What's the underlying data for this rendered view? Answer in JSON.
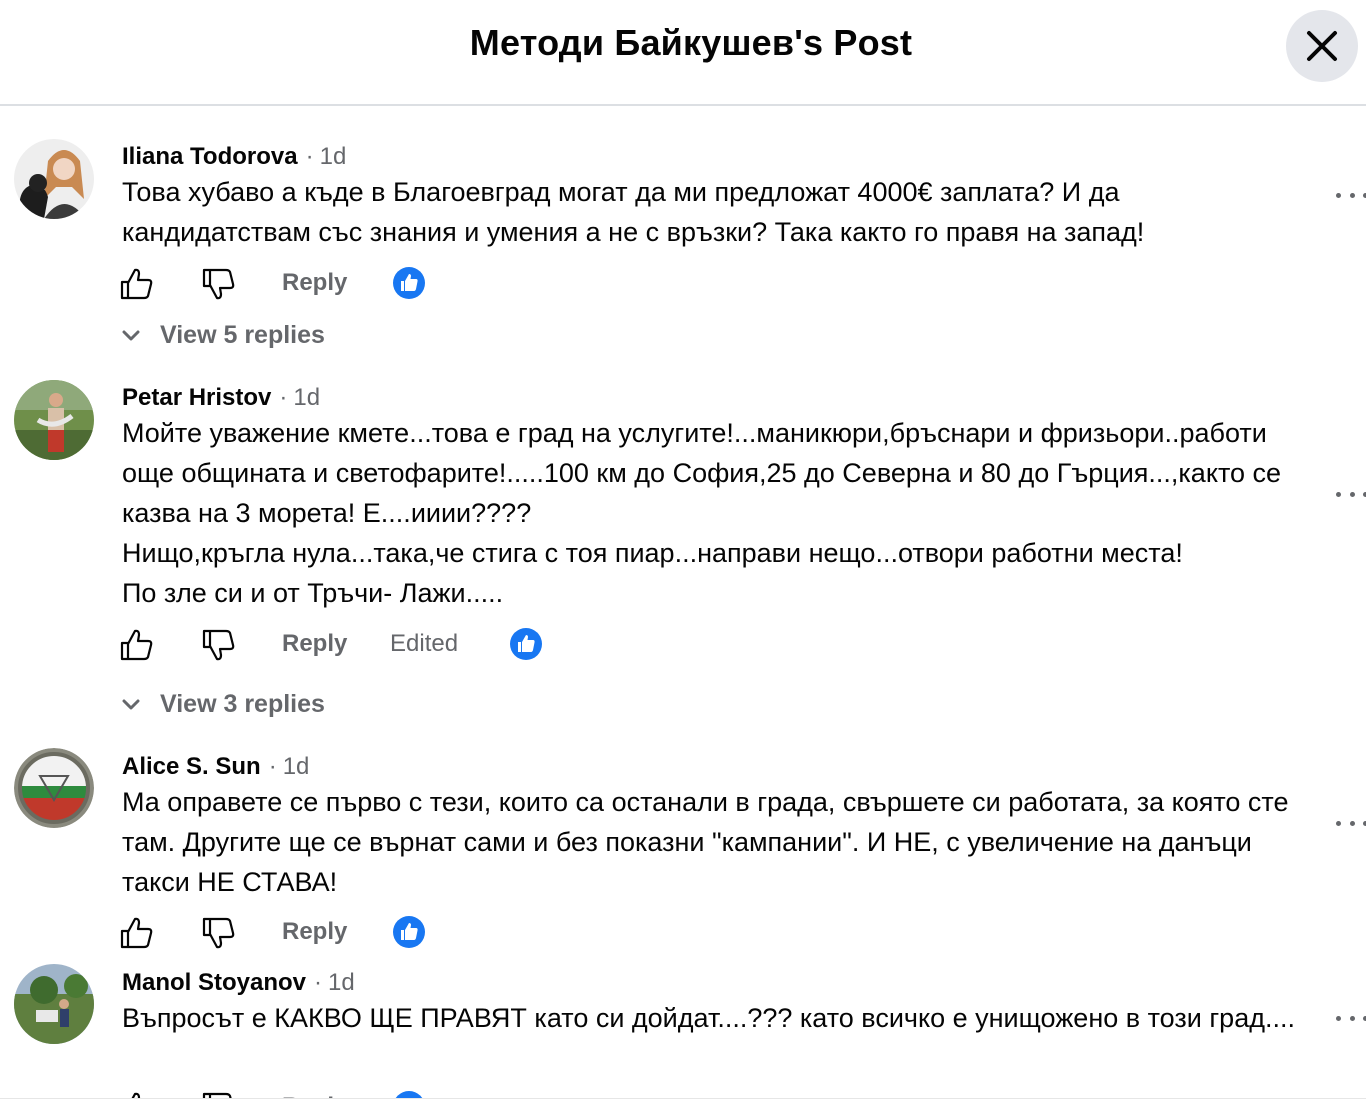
{
  "header": {
    "title": "Методи Байкушев's Post",
    "close_icon": "close-icon"
  },
  "ui": {
    "reply_label": "Reply",
    "edited_label": "Edited",
    "dot": "·",
    "like_icon": "thumbs-up-icon",
    "dislike_icon": "thumbs-down-icon",
    "more_icon": "more-horizontal-icon",
    "reaction_icon": "like-reaction-icon",
    "chevron_icon": "chevron-down-icon"
  },
  "colors": {
    "secondary_text": "#65676b",
    "reaction_blue": "#1877f2",
    "close_bg": "#e4e6eb"
  },
  "comments": [
    {
      "author": "Iliana Todorova",
      "time": "1d",
      "lines": [
        "Това хубаво а къде в Благоевград могат да ми предложат 4000€ заплата? И да кандидатствам със знания и умения а не с връзки? Така както го правя на запад!"
      ],
      "view_replies": "View 5 replies"
    },
    {
      "author": "Petar Hristov",
      "time": "1d",
      "lines": [
        "Мойте уважение кмете...това е град на услугите!...маникюри,бръснари и фризьори..работи още общината и светофарите!.....100 км до София,25 до Северна и 80 до Гърция...,както се казва на 3 морета! Е....ииии????",
        "Нищо,кръгла нула...така,че стига с тоя пиар...направи нещо...отвори работни места!",
        "По зле си и от Тръчи- Лажи....."
      ],
      "edited": true,
      "view_replies": "View 3 replies"
    },
    {
      "author": "Alice S. Sun",
      "time": "1d",
      "lines": [
        "Ма оправете се първо с тези, които са останали в града, свършете си работата, за която сте там. Другите ще се върнат сами и без показни \"кампании\". И НЕ, с увеличение на данъци такси НЕ СТАВА!"
      ]
    },
    {
      "author": "Manol Stoyanov",
      "time": "1d",
      "lines": [
        "Въпросът е КАКВО ЩЕ ПРАВЯТ като си дойдат....??? като всичко е унищожено в този град...."
      ]
    }
  ]
}
